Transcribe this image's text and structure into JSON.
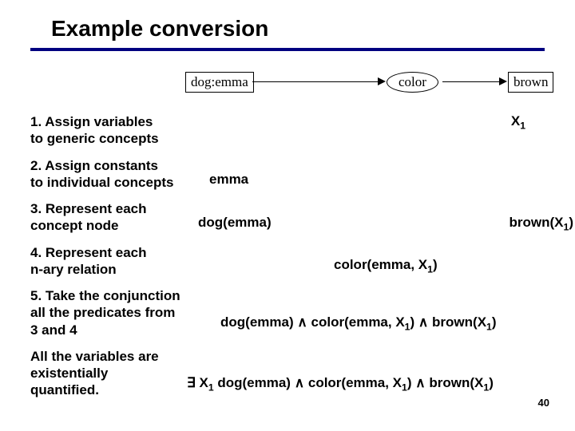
{
  "title": "Example conversion",
  "diagram": {
    "box1": "dog:emma",
    "ellipse": "color",
    "box2": "brown"
  },
  "steps": {
    "s1_l1": "1. Assign variables",
    "s1_l2": "to generic concepts",
    "s2_l1": "2. Assign constants",
    "s2_l2": "to individual concepts",
    "s3_l1": "3. Represent each",
    "s3_l2": "concept node",
    "s4_l1": "4. Represent each",
    "s4_l2": "n-ary relation",
    "s5_l1": "5. Take the conjunction",
    "s5_l2": "all the predicates from",
    "s5_l3": "3 and 4",
    "s6_l1": "All the variables are",
    "s6_l2": "existentially",
    "s6_l3": "quantified."
  },
  "vals": {
    "x1_pre": "X",
    "x1_sub": "1",
    "emma": "emma",
    "dog": "dog(emma)",
    "brown_pre": "brown(X",
    "brown_sub": "1",
    "brown_post": ")",
    "color_pre": "color(emma, X",
    "color_sub": "1",
    "color_post": ")",
    "conj_a": "dog(emma) ",
    "and": "∧",
    "conj_b": "  color(emma, X",
    "conj_b_sub": "1",
    "conj_c": ") ",
    "conj_d": " brown(X",
    "conj_d_sub": "1",
    "conj_e": ")",
    "exists": "∃",
    "ex_a": " X",
    "ex_a_sub": "1",
    "ex_b": " dog(emma) ",
    "ex_c": "  color(emma, X",
    "ex_c_sub": "1",
    "ex_d": ") ",
    "ex_e": " brown(X",
    "ex_e_sub": "1",
    "ex_f": ")"
  },
  "page_number": "40"
}
